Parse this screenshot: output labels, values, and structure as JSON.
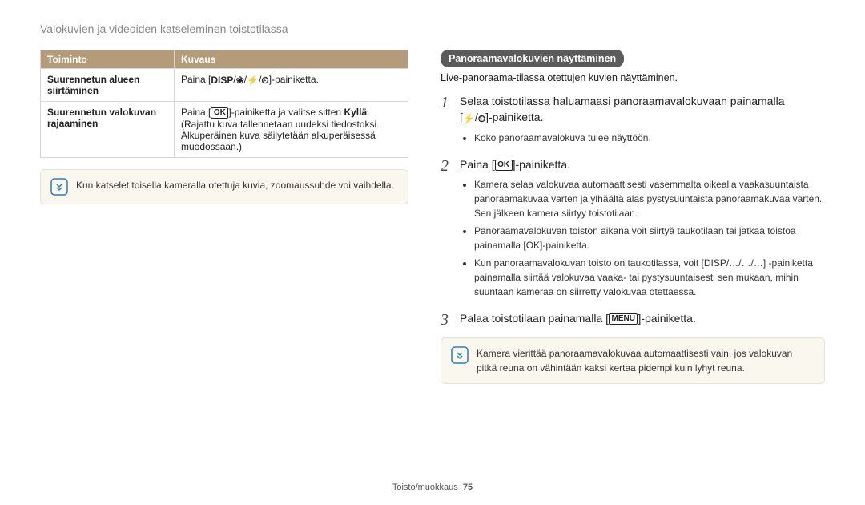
{
  "page_title": "Valokuvien ja videoiden katseleminen toistotilassa",
  "table": {
    "headers": [
      "Toiminto",
      "Kuvaus"
    ],
    "rows": [
      {
        "toiminto": "Suurennetun alueen siirtäminen",
        "kuvaus_prefix": "Paina [",
        "kuvaus_suffix": "]-painiketta."
      },
      {
        "toiminto": "Suurennetun valokuvan rajaaminen",
        "kuvaus_prefix": "Paina [",
        "kuvaus_mid": "]-painiketta ja valitse sitten ",
        "kuvaus_bold": "Kyllä",
        "kuvaus_suffix": ". (Rajattu kuva tallennetaan uudeksi tiedostoksi. Alkuperäinen kuva säilytetään alkuperäisessä muodossaan.)"
      }
    ]
  },
  "left_note": "Kun katselet toisella kameralla otettuja kuvia, zoomaussuhde voi vaihdella.",
  "section_heading": "Panoraamavalokuvien näyttäminen",
  "section_sub": "Live-panoraama-tilassa otettujen kuvien näyttäminen.",
  "steps": {
    "s1": {
      "line1": "Selaa toistotilassa haluamaasi panoraamavalokuvaan painamalla",
      "line2_prefix": "[",
      "line2_suffix": "]-painiketta.",
      "bullets": [
        "Koko panoraamavalokuva tulee näyttöön."
      ]
    },
    "s2": {
      "line_prefix": "Paina [",
      "line_suffix": "]-painiketta.",
      "bullets": [
        "Kamera selaa valokuvaa automaattisesti vasemmalta oikealla vaakasuuntaista panoraamakuvaa varten ja ylhäältä alas pystysuuntaista panoraamakuvaa varten. Sen jälkeen kamera siirtyy toistotilaan.",
        "Panoraamavalokuvan toiston aikana voit siirtyä taukotilaan tai jatkaa toistoa painamalla [OK]-painiketta.",
        "Kun panoraamavalokuvan toisto on taukotilassa, voit [DISP/…/…/…] -painiketta painamalla siirtää valokuvaa vaaka- tai pystysuuntaisesti sen mukaan, mihin suuntaan kameraa on siirretty valokuvaa otettaessa."
      ]
    },
    "s3": {
      "line_prefix": "Palaa toistotilaan painamalla [",
      "line_suffix": "]-painiketta."
    }
  },
  "right_note": "Kamera vierittää panoraamavalokuvaa automaattisesti vain, jos valokuvan pitkä reuna on vähintään kaksi kertaa pidempi kuin lyhyt reuna.",
  "footer_label": "Toisto/muokkaus",
  "footer_page": "75",
  "glyphs": {
    "disp": "DISP",
    "ok": "OK",
    "menu": "MENU",
    "flower": "❀",
    "flash": "⚡",
    "timer": "⏲",
    "sep": "/"
  }
}
